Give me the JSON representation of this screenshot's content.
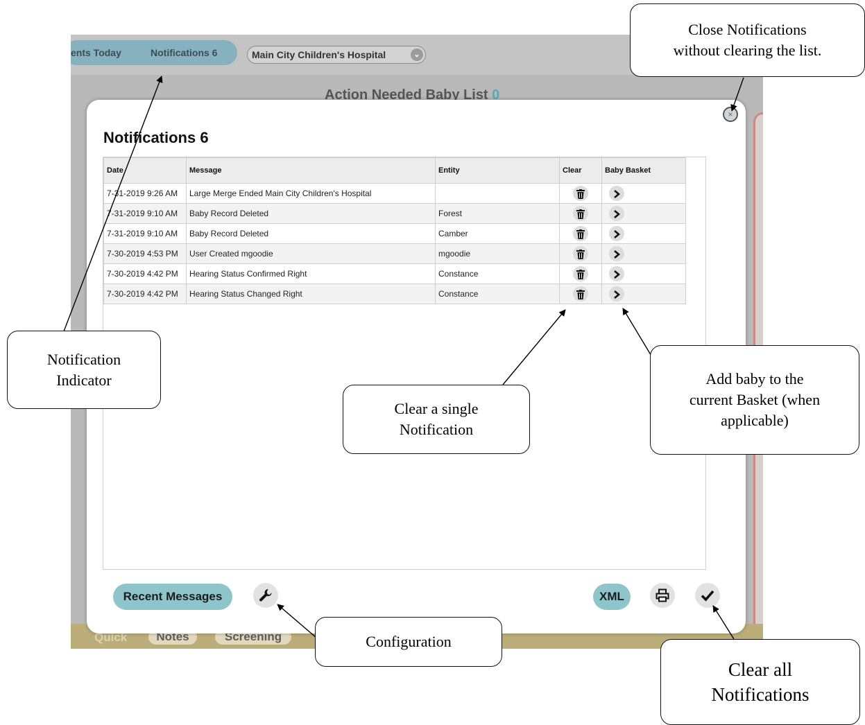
{
  "topbar": {
    "tab_partial": "ents Today",
    "tab_notifications": "Notifications 6",
    "hospital_select": "Main City Children's Hospital"
  },
  "background": {
    "action_title": "Action Needed Baby List",
    "action_count": "0",
    "bottom_tabs": [
      "Quick",
      "Notes",
      "Screening"
    ]
  },
  "modal": {
    "title": "Notifications 6",
    "columns": [
      "Date",
      "Message",
      "Entity",
      "Clear",
      "Baby Basket"
    ],
    "rows": [
      {
        "date": "7-31-2019 9:26 AM",
        "message": "Large Merge Ended Main City Children's Hospital",
        "entity": ""
      },
      {
        "date": "7-31-2019 9:10 AM",
        "message": "Baby Record Deleted",
        "entity": "Forest"
      },
      {
        "date": "7-31-2019 9:10 AM",
        "message": "Baby Record Deleted",
        "entity": "Camber"
      },
      {
        "date": "7-30-2019 4:53 PM",
        "message": "User Created mgoodie",
        "entity": "mgoodie"
      },
      {
        "date": "7-30-2019 4:42 PM",
        "message": "Hearing Status Confirmed Right",
        "entity": "Constance"
      },
      {
        "date": "7-30-2019 4:42 PM",
        "message": "Hearing Status Changed Right",
        "entity": "Constance"
      }
    ],
    "recent_messages_label": "Recent Messages",
    "xml_label": "XML"
  },
  "callouts": {
    "close": [
      "Close Notifications",
      "without clearing the list."
    ],
    "indicator": [
      "Notification",
      "Indicator"
    ],
    "clear_single": [
      "Clear a single",
      "Notification"
    ],
    "add_baby": [
      "Add baby to the",
      "current Basket (when",
      "applicable)"
    ],
    "configuration": [
      "Configuration"
    ],
    "clear_all": [
      "Clear all",
      "Notifications"
    ]
  },
  "icons": {
    "trash": "trash-icon",
    "chevron": "chevron-right-icon",
    "wrench": "wrench-icon",
    "print": "printer-icon",
    "check": "check-icon",
    "close": "close-icon"
  },
  "colors": {
    "accent_teal": "#86b2bf",
    "pill_teal": "#8ec5cb",
    "count_teal": "#5aa7b9",
    "bottom_bar": "#bcae7a"
  }
}
